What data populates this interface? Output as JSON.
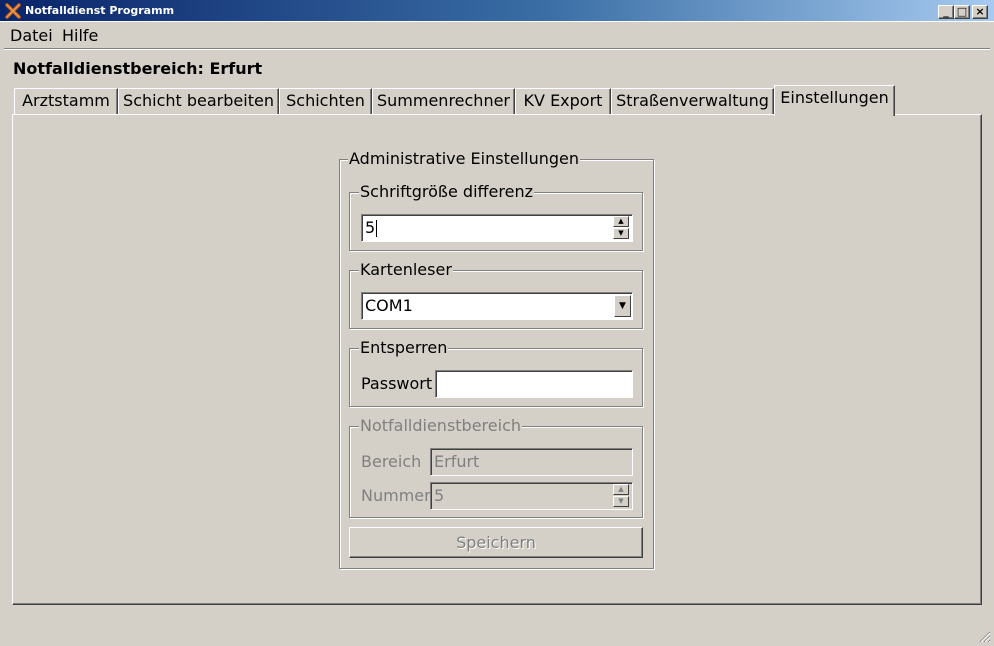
{
  "window": {
    "title": "Notfalldienst Programm",
    "minimize_glyph": "_",
    "maximize_glyph": "□",
    "close_glyph": "×"
  },
  "menu": {
    "items": [
      "Datei",
      "Hilfe"
    ]
  },
  "area_label": "Notfalldienstbereich: Erfurt",
  "tabs": [
    {
      "label": "Arztstamm"
    },
    {
      "label": "Schicht bearbeiten"
    },
    {
      "label": "Schichten"
    },
    {
      "label": "Summenrechner"
    },
    {
      "label": "KV Export"
    },
    {
      "label": "Straßenverwaltung"
    },
    {
      "label": "Einstellungen",
      "active": true
    }
  ],
  "settings": {
    "group_title": "Administrative Einstellungen",
    "font_size": {
      "title": "Schriftgröße differenz",
      "value": "5"
    },
    "card_reader": {
      "title": "Kartenleser",
      "selected": "COM1"
    },
    "unlock": {
      "title": "Entsperren",
      "password_label": "Passwort",
      "password_value": ""
    },
    "area": {
      "title": "Notfalldienstbereich",
      "region_label": "Bereich",
      "region_value": "Erfurt",
      "number_label": "Nummer",
      "number_value": "5"
    },
    "save_label": "Speichern"
  },
  "icons": {
    "app": "app-icon",
    "spin_up": "▲",
    "spin_down": "▼",
    "dropdown": "▼"
  },
  "colors": {
    "face": "#d4d0c8",
    "title_start": "#0a246a",
    "title_end": "#a6caf0",
    "disabled": "#808080"
  }
}
